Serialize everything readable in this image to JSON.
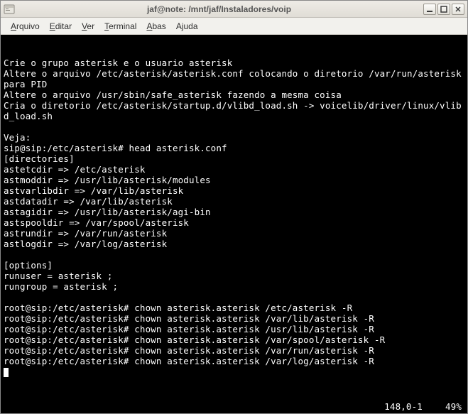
{
  "titlebar": {
    "title": "jaf@note: /mnt/jaf/Instaladores/voip"
  },
  "menubar": {
    "arquivo": "Arquivo",
    "editar": "Editar",
    "ver": "Ver",
    "terminal": "Terminal",
    "abas": "Abas",
    "ajuda": "Ajuda"
  },
  "terminal": {
    "lines": "Crie o grupo asterisk e o usuario asterisk\nAltere o arquivo /etc/asterisk/asterisk.conf colocando o diretorio /var/run/asterisk para PID\nAltere o arquivo /usr/sbin/safe_asterisk fazendo a mesma coisa\nCria o diretorio /etc/asterisk/startup.d/vlibd_load.sh -> voicelib/driver/linux/vlibd_load.sh\n\nVeja:\nsip@sip:/etc/asterisk# head asterisk.conf\n[directories]\nastetcdir => /etc/asterisk\nastmoddir => /usr/lib/asterisk/modules\nastvarlibdir => /var/lib/asterisk\nastdatadir => /var/lib/asterisk\nastagidir => /usr/lib/asterisk/agi-bin\nastspooldir => /var/spool/asterisk\nastrundir => /var/run/asterisk\nastlogdir => /var/log/asterisk\n\n[options]\nrunuser = asterisk ;\nrungroup = asterisk ;\n\nroot@sip:/etc/asterisk# chown asterisk.asterisk /etc/asterisk -R\nroot@sip:/etc/asterisk# chown asterisk.asterisk /var/lib/asterisk -R\nroot@sip:/etc/asterisk# chown asterisk.asterisk /usr/lib/asterisk -R\nroot@sip:/etc/asterisk# chown asterisk.asterisk /var/spool/asterisk -R\nroot@sip:/etc/asterisk# chown asterisk.asterisk /var/run/asterisk -R\nroot@sip:/etc/asterisk# chown asterisk.asterisk /var/log/asterisk -R",
    "status_pos": "148,0-1",
    "status_pct": "49%"
  }
}
